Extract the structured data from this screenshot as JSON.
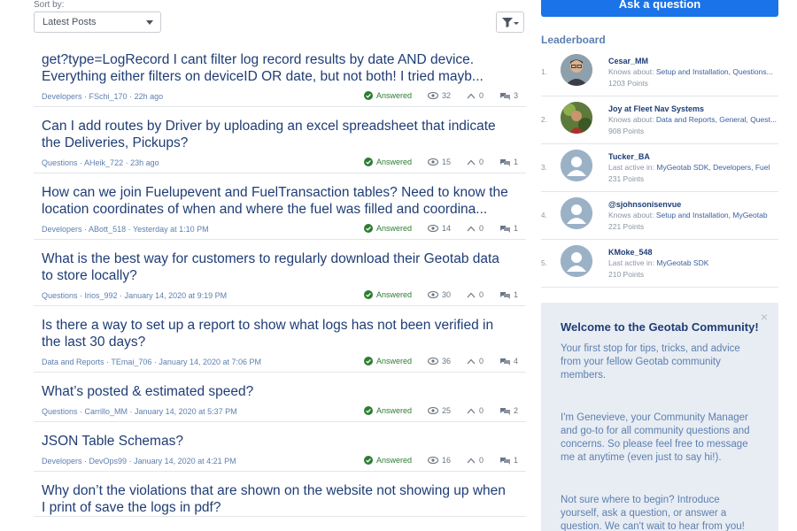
{
  "sort": {
    "label": "Sort by:",
    "value": "Latest Posts"
  },
  "ask_button": "Ask a question",
  "posts": [
    {
      "title": "get?type=LogRecord I cant filter log record results by date AND device. Everything either filters on deviceID OR date, but not both! I tried mayb...",
      "category": "Developers",
      "author": "FSchi_170",
      "time": "22h ago",
      "status": "Answered",
      "views": "32",
      "votes": "0",
      "comments": "3"
    },
    {
      "title": "Can I add routes by Driver by uploading an excel spreadsheet that indicate the Deliveries, Pickups?",
      "category": "Questions",
      "author": "AHeik_722",
      "time": "23h ago",
      "status": "Answered",
      "views": "15",
      "votes": "0",
      "comments": "1"
    },
    {
      "title": "How can we join Fuelupevent and FuelTransaction tables? Need to know the location coordinates of when and where the fuel was filled and coordina...",
      "category": "Developers",
      "author": "ABott_518",
      "time": "Yesterday at 1:10 PM",
      "status": "Answered",
      "views": "14",
      "votes": "0",
      "comments": "1"
    },
    {
      "title": "What is the best way for customers to regularly download their Geotab data to store locally?",
      "category": "Questions",
      "author": "Irios_992",
      "time": "January 14, 2020 at 9:19 PM",
      "status": "Answered",
      "views": "30",
      "votes": "0",
      "comments": "1"
    },
    {
      "title": "Is there a way to set up a report to show what logs has not been verified in the last 30 days?",
      "category": "Data and Reports",
      "author": "TEmai_706",
      "time": "January 14, 2020 at 7:06 PM",
      "status": "Answered",
      "views": "36",
      "votes": "0",
      "comments": "4"
    },
    {
      "title": "What’s posted & estimated speed?",
      "category": "Questions",
      "author": "Carrillo_MM",
      "time": "January 14, 2020 at 5:37 PM",
      "status": "Answered",
      "views": "25",
      "votes": "0",
      "comments": "2"
    },
    {
      "title": "JSON Table Schemas?",
      "category": "Developers",
      "author": "DevOps99",
      "time": "January 14, 2020 at 4:21 PM",
      "status": "Answered",
      "views": "16",
      "votes": "0",
      "comments": "1"
    },
    {
      "title": "Why don’t the violations that are shown on the website not showing up when I print of save the logs in pdf?",
      "category": "",
      "author": "",
      "time": "",
      "status": "",
      "views": "",
      "votes": "",
      "comments": ""
    }
  ],
  "leaderboard": {
    "title": "Leaderboard",
    "items": [
      {
        "rank": "1.",
        "name": "Cesar_MM",
        "about_label": "Knows about:",
        "about": "Setup and Installation, Questions...",
        "points": "1203 Points",
        "avatar": "photo-cesar"
      },
      {
        "rank": "2.",
        "name": "Joy at Fleet Nav Systems",
        "about_label": "Knows about:",
        "about": "Data and Reports, General, Quest...",
        "points": "908 Points",
        "avatar": "photo-joy"
      },
      {
        "rank": "3.",
        "name": "Tucker_BA",
        "about_label": "Last active in:",
        "about": "MyGeotab SDK, Developers, Fuel",
        "points": "231 Points",
        "avatar": "default"
      },
      {
        "rank": "4.",
        "name": "@sjohnsonisenvue",
        "about_label": "Knows about:",
        "about": "Setup and Installation, MyGeotab",
        "points": "221 Points",
        "avatar": "default"
      },
      {
        "rank": "5.",
        "name": "KMoke_548",
        "about_label": "Last active in:",
        "about": "MyGeotab SDK",
        "points": "210 Points",
        "avatar": "default"
      }
    ]
  },
  "welcome": {
    "title": "Welcome to the Geotab Community!",
    "close": "×",
    "p1": "Your first stop for tips, tricks, and advice from your fellow Geotab community members.",
    "p2": "I'm Genevieve, your Community Manager and go-to for all community questions and concerns. So please feel free to message me at anytime (even just to say hi!).",
    "p3": "Not sure where to begin? Introduce yourself, ask a question, or answer a question. We can't wait to hear from you!"
  },
  "colors": {
    "accent": "#1a73e8",
    "answered": "#2e7d32",
    "title": "#1f3d75"
  }
}
